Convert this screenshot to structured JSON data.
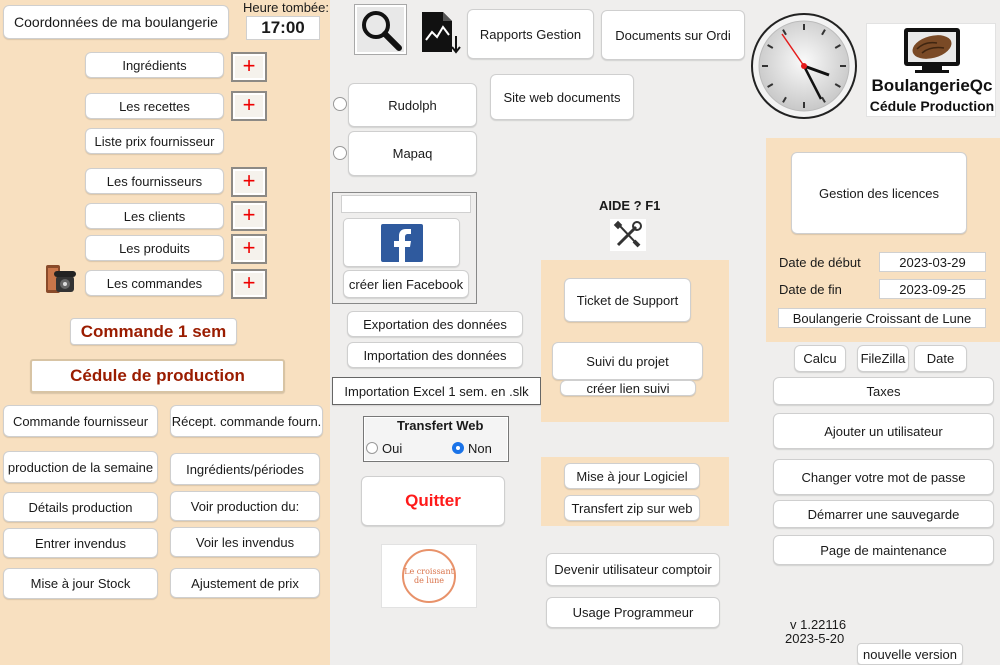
{
  "left": {
    "coordonnees_label": "Coordonnées de ma boulangerie",
    "heure_tombee_label": "Heure tombée:",
    "heure_tombee_value": "17:00",
    "ingredients_label": "Ingrédients",
    "recettes_label": "Les recettes",
    "prix_fournisseur_label": "Liste prix fournisseur",
    "fournisseurs_label": "Les fournisseurs",
    "clients_label": "Les clients",
    "produits_label": "Les produits",
    "commandes_label": "Les commandes",
    "plus_symbol": "+",
    "commande_1sem_label": "Commande 1 sem",
    "cedule_label": "Cédule de production",
    "commande_fournisseur_label": "Commande fournisseur",
    "recept_commande_label": "Récept. commande fourn.",
    "production_semaine_label": "production de la semaine",
    "ingredients_periodes_label": "Ingrédients/périodes",
    "details_production_label": "Détails production",
    "voir_production_label": "Voir production du:",
    "entrer_invendus_label": "Entrer invendus",
    "voir_invendus_label": "Voir les invendus",
    "mise_a_jour_stock_label": "Mise à jour Stock",
    "ajustement_prix_label": "Ajustement de prix"
  },
  "middle": {
    "rapports_label": "Rapports Gestion",
    "documents_ordi_label": "Documents sur Ordi",
    "rudolph_label": "Rudolph",
    "mapaq_label": "Mapaq",
    "site_web_docs_label": "Site web documents",
    "facebook_url_value": "",
    "creer_lien_fb_label": "créer lien Facebook",
    "exportation_label": "Exportation des données",
    "importation_label": "Importation des données",
    "import_excel_label": "Importation Excel 1 sem. en .slk",
    "transfert_web_title": "Transfert Web",
    "oui_label": "Oui",
    "non_label": "Non",
    "quitter_label": "Quitter",
    "logo_text_line1": "Le croissant",
    "logo_text_line2": "de lune",
    "aide_label": "AIDE ? F1",
    "ticket_support_label": "Ticket de Support",
    "suivi_projet_label": "Suivi du projet",
    "creer_lien_suivi_label": "créer lien suivi",
    "mise_a_jour_logiciel_label": "Mise à jour Logiciel",
    "transfert_zip_label": "Transfert zip sur web",
    "devenir_comptoir_label": "Devenir utilisateur comptoir",
    "usage_programmeur_label": "Usage Programmeur"
  },
  "right": {
    "brand_name": "BoulangerieQc",
    "brand_sub": "Cédule Production",
    "gestion_licences_label": "Gestion des licences",
    "date_debut_label": "Date de début",
    "date_debut_value": "2023-03-29",
    "date_fin_label": "Date de fin",
    "date_fin_value": "2023-09-25",
    "company_value": "Boulangerie Croissant de Lune",
    "calcu_label": "Calcu",
    "filezilla_label": "FileZilla",
    "date_label": "Date",
    "taxes_label": "Taxes",
    "ajouter_utilisateur_label": "Ajouter un utilisateur",
    "changer_mdp_label": "Changer votre mot de passe",
    "demarrer_sauvegarde_label": "Démarrer une sauvegarde",
    "page_maintenance_label": "Page de maintenance",
    "version_label": "v 1.22116",
    "version_date": "2023-5-20",
    "nouvelle_version_label": "nouvelle version"
  },
  "colors": {
    "panel": "#f8e0c0",
    "plus_red": "#e00000",
    "title_red": "#9a1c00",
    "quitter_red": "#ff1a1a",
    "radio_blue": "#1a73e8",
    "facebook_blue": "#2f5a9e"
  },
  "icons": [
    "search-icon",
    "report-download-icon",
    "clock-icon",
    "facebook-icon",
    "tools-icon",
    "phone-icon",
    "laptop-bread-icon",
    "croissant-logo"
  ]
}
